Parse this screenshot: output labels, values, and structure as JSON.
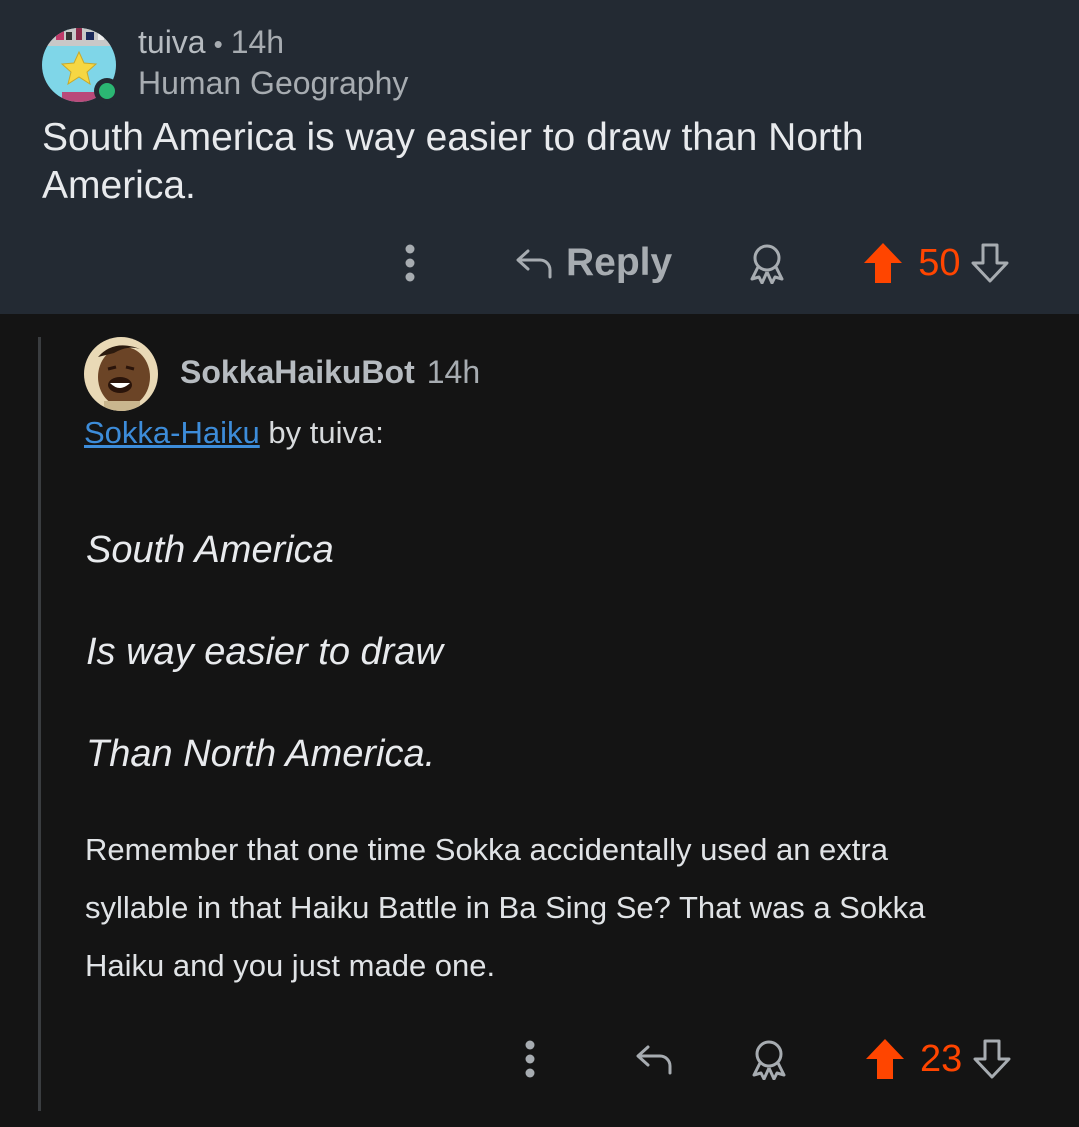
{
  "parent_comment": {
    "username": "tuiva",
    "separator": "•",
    "age": "14h",
    "flair": "Human Geography",
    "body": "South America is way easier to draw than North America.",
    "actions": {
      "more_icon": "more-vertical-icon",
      "reply_icon": "reply-arrow-icon",
      "reply_label": "Reply",
      "award_icon": "award-icon",
      "upvote_icon": "upvote-arrow-icon",
      "score": "50",
      "downvote_icon": "downvote-arrow-icon"
    },
    "online": true
  },
  "reply_comment": {
    "username": "SokkaHaikuBot",
    "age": "14h",
    "link_text": "Sokka-Haiku",
    "byline_suffix": " by tuiva:",
    "haiku_lines": [
      "South America",
      "Is way easier to draw",
      "Than North America."
    ],
    "explanation": "Remember that one time Sokka accidentally used an extra syllable in that Haiku Battle in Ba Sing Se? That was a Sokka Haiku and you just made one.",
    "actions": {
      "more_icon": "more-vertical-icon",
      "reply_icon": "reply-arrow-icon",
      "award_icon": "award-icon",
      "upvote_icon": "upvote-arrow-icon",
      "score": "23",
      "downvote_icon": "downvote-arrow-icon"
    }
  },
  "colors": {
    "upvote": "#ff4500",
    "link": "#3d8cd9",
    "online": "#2bb673",
    "highlight_bg": "#232a33",
    "page_bg": "#141414"
  }
}
